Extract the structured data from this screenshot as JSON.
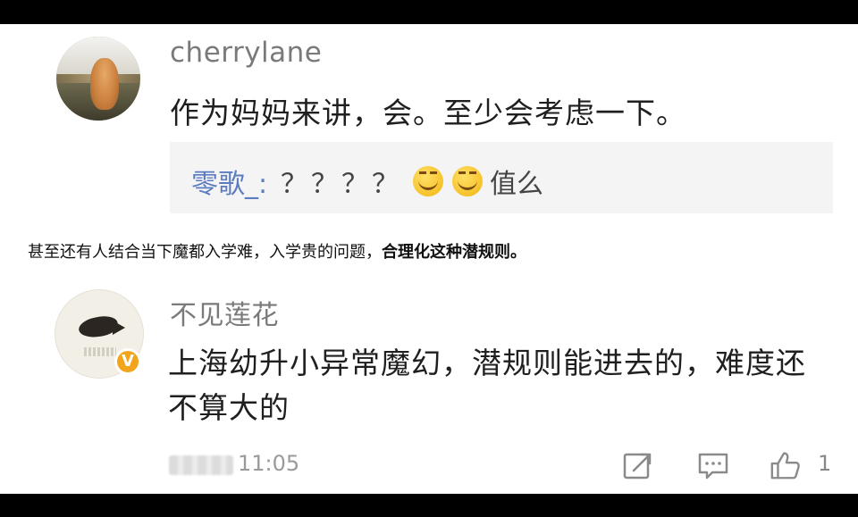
{
  "comment_top": {
    "username": "cherrylane",
    "text": "作为妈妈来讲，会。至少会考虑一下。",
    "reply": {
      "user": "零歌_:",
      "before_emoji": "？？？？",
      "after_emoji": "值么",
      "emoji_names": [
        "grin-emoji",
        "grin-emoji"
      ]
    }
  },
  "caption": {
    "normal": "甚至还有人结合当下魔都入学难，入学贵的问题，",
    "bold": "合理化这种潜规则。"
  },
  "comment_bottom": {
    "username": "不见莲花",
    "text": "上海幼升小异常魔幻，潜规则能进去的，难度还不算大的",
    "badge": "V",
    "time": "11:05",
    "like_count": "1",
    "icons": [
      "share-icon",
      "comment-icon",
      "thumbs-up-icon"
    ]
  },
  "colors": {
    "username": "#7a7a7a",
    "reply_user": "#5b7cc0",
    "badge": "#f2a51a"
  }
}
